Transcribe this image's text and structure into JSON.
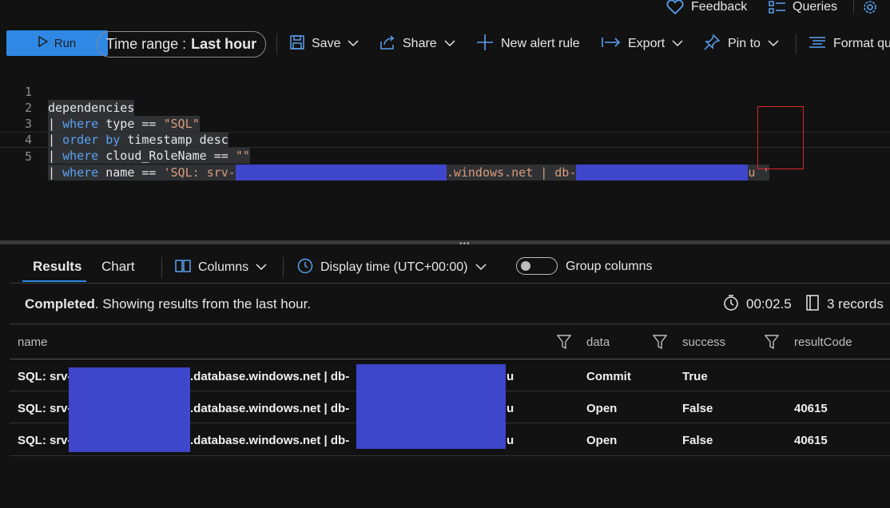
{
  "top_links": {
    "feedback": "Feedback",
    "queries": "Queries"
  },
  "toolbar": {
    "run": "Run",
    "time_range_label": "Time range :",
    "time_range_value": "Last hour",
    "save": "Save",
    "share": "Share",
    "new_alert": "New alert rule",
    "export": "Export",
    "pin_to": "Pin to",
    "format": "Format qu"
  },
  "editor": {
    "lines": [
      {
        "num": "1",
        "text": "dependencies"
      },
      {
        "num": "2",
        "pipe": "| ",
        "kw": "where",
        "rest": " type == ",
        "str": "\"SQL\""
      },
      {
        "num": "3",
        "pipe": "| ",
        "kw": "order by",
        "rest": " timestamp desc"
      },
      {
        "num": "4",
        "pipe": "| ",
        "kw": "where",
        "rest": " cloud_RoleName == ",
        "str": "\"\""
      },
      {
        "num": "5",
        "pipe": "| ",
        "kw": "where",
        "rest": " name == ",
        "str_a": "'SQL: srv-",
        "str_b": ".windows.net | db-",
        "str_c": "u '"
      }
    ]
  },
  "results": {
    "tab_results": "Results",
    "tab_chart": "Chart",
    "columns": "Columns",
    "display_time": "Display time (UTC+00:00)",
    "group_columns": "Group columns",
    "status_bold": "Completed",
    "status_rest": ". Showing results from the last hour.",
    "duration": "00:02.5",
    "records": "3 records"
  },
  "table": {
    "headers": {
      "name": "name",
      "data": "data",
      "success": "success",
      "resultCode": "resultCode"
    },
    "rows": [
      {
        "name_a": "SQL: srv-",
        "name_b": ".database.windows.net | db-",
        "name_c": "u",
        "data": "Commit",
        "success": "True",
        "resultCode": ""
      },
      {
        "name_a": "SQL: srv-",
        "name_b": ".database.windows.net | db-",
        "name_c": "u",
        "data": "Open",
        "success": "False",
        "resultCode": "40615"
      },
      {
        "name_a": "SQL: srv-",
        "name_b": ".database.windows.net | db-",
        "name_c": "u",
        "data": "Open",
        "success": "False",
        "resultCode": "40615"
      }
    ]
  },
  "colors": {
    "accent": "#2f89e4",
    "redaction": "#3e46cc",
    "annotation": "#d9262b",
    "keyword": "#5aa0ef",
    "string": "#d99b7a"
  },
  "icons": [
    "heart-icon",
    "list-icon",
    "gear-icon",
    "play-icon",
    "save-icon",
    "share-icon",
    "plus-icon",
    "export-arrow-icon",
    "pin-icon",
    "format-icon",
    "chevron-down-icon",
    "columns-icon",
    "clock-icon",
    "stopwatch-icon",
    "records-icon",
    "filter-icon"
  ]
}
